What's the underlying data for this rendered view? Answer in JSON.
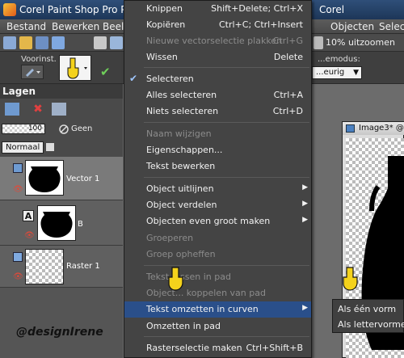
{
  "window": {
    "title": "Corel Paint Shop Pro Photo",
    "title_right": "Corel"
  },
  "menubar": [
    "Bestand",
    "Bewerken",
    "Beeld",
    "Objecten",
    "Selecties"
  ],
  "toolbar": {
    "zoom_label": "10% uitzoomen"
  },
  "options": {
    "preset_label": "Voorinst.",
    "modus_label": "...emodus:",
    "modus_value": "...eurig"
  },
  "layers": {
    "title": "Lagen",
    "opacity": "100",
    "fill_label": "Geen",
    "blend_mode": "Normaal",
    "items": [
      {
        "name": "Vector 1"
      },
      {
        "name": "B",
        "type_icon": "A"
      },
      {
        "name": "Raster 1"
      }
    ]
  },
  "image_window": {
    "title": "Image3* @"
  },
  "context_menu": {
    "items": [
      {
        "label": "Knippen",
        "shortcut": "Shift+Delete; Ctrl+X",
        "mnemonic": "K"
      },
      {
        "label": "Kopiëren",
        "shortcut": "Ctrl+C; Ctrl+Insert"
      },
      {
        "label": "Nieuwe vectorselectie plakken",
        "shortcut": "Ctrl+G",
        "disabled": true
      },
      {
        "label": "Wissen",
        "shortcut": "Delete"
      },
      {
        "label": "Selecteren",
        "checked": true
      },
      {
        "label": "Alles selecteren",
        "shortcut": "Ctrl+A"
      },
      {
        "label": "Niets selecteren",
        "shortcut": "Ctrl+D"
      },
      {
        "label": "Naam wijzigen",
        "disabled": true
      },
      {
        "label": "Eigenschappen..."
      },
      {
        "label": "Tekst bewerken"
      },
      {
        "label": "Object uitlijnen",
        "submenu": true
      },
      {
        "label": "Object verdelen",
        "submenu": true
      },
      {
        "label": "Objecten even groot maken",
        "submenu": true
      },
      {
        "label": "Groeperen",
        "disabled": true
      },
      {
        "label": "Groep opheffen",
        "disabled": true
      },
      {
        "label": "Tekst ...ssen in pad",
        "disabled": true
      },
      {
        "label": "Object... koppelen van pad",
        "disabled": true
      },
      {
        "label": "Tekst omzetten in curven",
        "submenu": true,
        "highlighted": true
      },
      {
        "label": "Omzetten in pad"
      },
      {
        "label": "Rasterselectie maken",
        "shortcut": "Ctrl+Shift+B"
      }
    ]
  },
  "submenu": {
    "items": [
      "Als één vorm",
      "Als lettervormen"
    ]
  },
  "watermark": "@designIrene",
  "colors": {
    "highlight": "#2a4f8a",
    "menu_bg": "#444444",
    "titlebar": "#2f4f79"
  }
}
